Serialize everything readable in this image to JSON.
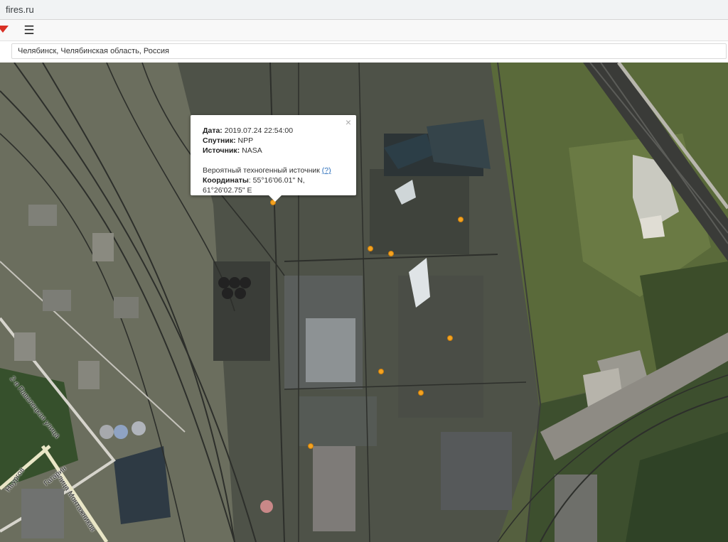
{
  "browser": {
    "url": "fires.ru"
  },
  "toolbar": {
    "menu_icon": "☰"
  },
  "search": {
    "value": "Челябинск, Челябинская область, Россия"
  },
  "popup": {
    "close": "×",
    "date_label": "Дата:",
    "date_value": "2019.07.24 22:54:00",
    "satellite_label": "Спутник:",
    "satellite_value": "NPP",
    "source_label": "Источник:",
    "source_value": "NASA",
    "note": "Вероятный техногенный источник",
    "help_link": "(?)",
    "coords_label": "Координаты",
    "coords_value": ": 55°16'06.01\" N, 61°26'02.75\" E"
  },
  "map": {
    "streets": [
      "2-я Павелецкая улица",
      "улица Монтажников",
      "Гагарин",
      "Ньургов"
    ],
    "hotspot_color": "#f4a321",
    "hotspot_count": 8
  }
}
